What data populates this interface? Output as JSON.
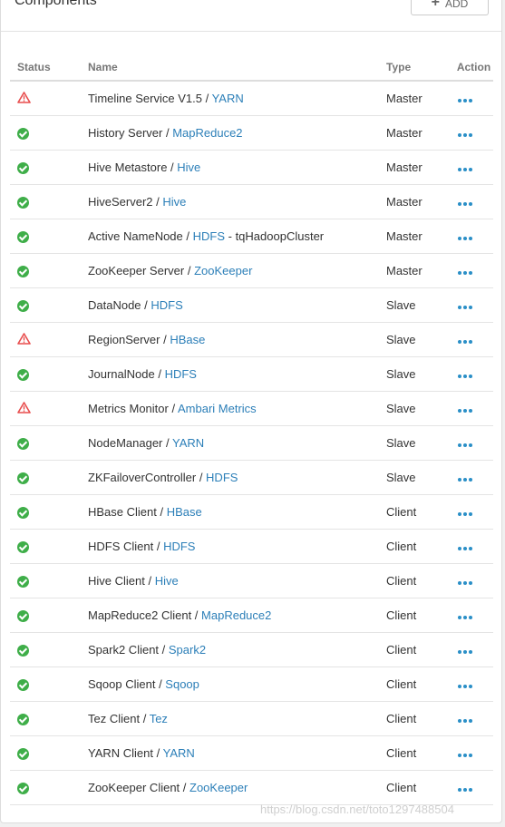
{
  "panel": {
    "title": "Components",
    "add_label": "ADD"
  },
  "table": {
    "headers": {
      "status": "Status",
      "name": "Name",
      "type": "Type",
      "action": "Action"
    },
    "rows": [
      {
        "status": "warning",
        "component": "Timeline Service V1.5",
        "service": "YARN",
        "suffix": "",
        "type": "Master"
      },
      {
        "status": "ok",
        "component": "History Server",
        "service": "MapReduce2",
        "suffix": "",
        "type": "Master"
      },
      {
        "status": "ok",
        "component": "Hive Metastore",
        "service": "Hive",
        "suffix": "",
        "type": "Master"
      },
      {
        "status": "ok",
        "component": "HiveServer2",
        "service": "Hive",
        "suffix": "",
        "type": "Master"
      },
      {
        "status": "ok",
        "component": "Active NameNode",
        "service": "HDFS",
        "suffix": " - tqHadoopCluster",
        "type": "Master"
      },
      {
        "status": "ok",
        "component": "ZooKeeper Server",
        "service": "ZooKeeper",
        "suffix": "",
        "type": "Master"
      },
      {
        "status": "ok",
        "component": "DataNode",
        "service": "HDFS",
        "suffix": "",
        "type": "Slave"
      },
      {
        "status": "warning",
        "component": "RegionServer",
        "service": "HBase",
        "suffix": "",
        "type": "Slave"
      },
      {
        "status": "ok",
        "component": "JournalNode",
        "service": "HDFS",
        "suffix": "",
        "type": "Slave"
      },
      {
        "status": "warning",
        "component": "Metrics Monitor",
        "service": "Ambari Metrics",
        "suffix": "",
        "type": "Slave"
      },
      {
        "status": "ok",
        "component": "NodeManager",
        "service": "YARN",
        "suffix": "",
        "type": "Slave"
      },
      {
        "status": "ok",
        "component": "ZKFailoverController",
        "service": "HDFS",
        "suffix": "",
        "type": "Slave"
      },
      {
        "status": "ok",
        "component": "HBase Client",
        "service": "HBase",
        "suffix": "",
        "type": "Client"
      },
      {
        "status": "ok",
        "component": "HDFS Client",
        "service": "HDFS",
        "suffix": "",
        "type": "Client"
      },
      {
        "status": "ok",
        "component": "Hive Client",
        "service": "Hive",
        "suffix": "",
        "type": "Client"
      },
      {
        "status": "ok",
        "component": "MapReduce2 Client",
        "service": "MapReduce2",
        "suffix": "",
        "type": "Client"
      },
      {
        "status": "ok",
        "component": "Spark2 Client",
        "service": "Spark2",
        "suffix": "",
        "type": "Client"
      },
      {
        "status": "ok",
        "component": "Sqoop Client",
        "service": "Sqoop",
        "suffix": "",
        "type": "Client"
      },
      {
        "status": "ok",
        "component": "Tez Client",
        "service": "Tez",
        "suffix": "",
        "type": "Client"
      },
      {
        "status": "ok",
        "component": "YARN Client",
        "service": "YARN",
        "suffix": "",
        "type": "Client"
      },
      {
        "status": "ok",
        "component": "ZooKeeper Client",
        "service": "ZooKeeper",
        "suffix": "",
        "type": "Client"
      }
    ]
  },
  "watermark": "https://blog.csdn.net/toto1297488504",
  "colors": {
    "ok": "#3fae49",
    "warning": "#e84d4d",
    "link": "#2c7fb8",
    "action": "#2a8fc7"
  }
}
